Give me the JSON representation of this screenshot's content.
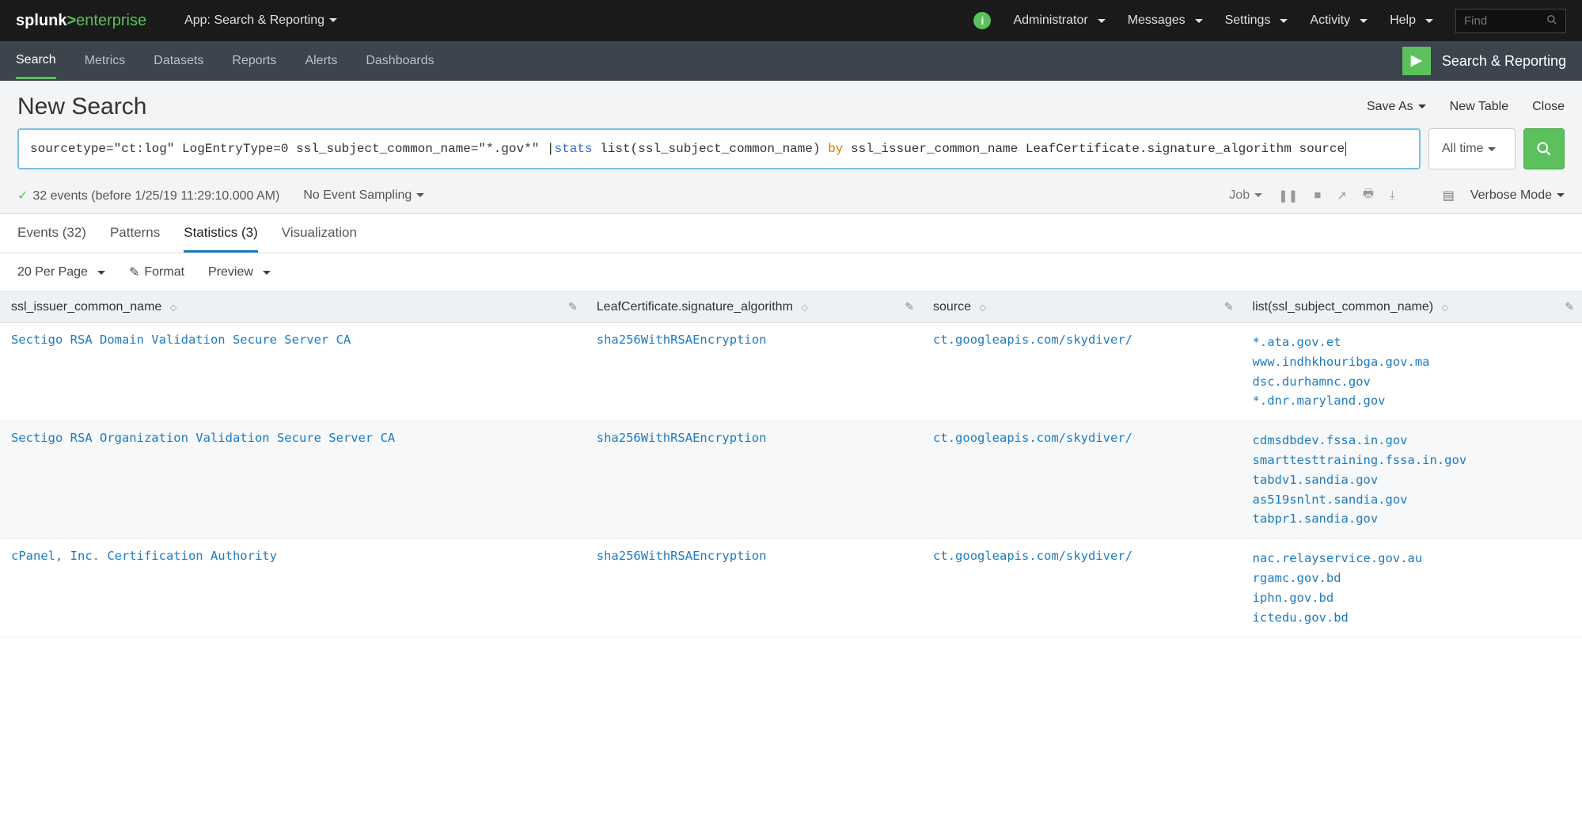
{
  "topbar": {
    "logo_prefix": "splunk",
    "logo_suffix": "enterprise",
    "app_label": "App: Search & Reporting",
    "items": [
      "Administrator",
      "Messages",
      "Settings",
      "Activity",
      "Help"
    ],
    "find_placeholder": "Find"
  },
  "nav": {
    "tabs": [
      "Search",
      "Metrics",
      "Datasets",
      "Reports",
      "Alerts",
      "Dashboards"
    ],
    "active_index": 0,
    "app_name": "Search & Reporting"
  },
  "search_header": {
    "title": "New Search",
    "actions": [
      "Save As",
      "New Table",
      "Close"
    ]
  },
  "search_query": {
    "prefix": "sourcetype=\"ct:log\" LogEntryType=0 ssl_subject_common_name=\"*.gov*\" | ",
    "cmd1": "stats",
    "mid1": " list(ssl_subject_common_name) ",
    "cmd2": "by",
    "suffix": " ssl_issuer_common_name LeafCertificate.signature_algorithm source"
  },
  "time_picker": "All time",
  "status": {
    "events_text": "32 events (before 1/25/19 11:29:10.000 AM)",
    "sampling": "No Event Sampling",
    "job_label": "Job",
    "mode": "Verbose Mode"
  },
  "result_tabs": {
    "items": [
      "Events (32)",
      "Patterns",
      "Statistics (3)",
      "Visualization"
    ],
    "active_index": 2
  },
  "table_toolbar": {
    "per_page": "20 Per Page",
    "format": "Format",
    "preview": "Preview"
  },
  "columns": [
    "ssl_issuer_common_name",
    "LeafCertificate.signature_algorithm",
    "source",
    "list(ssl_subject_common_name)"
  ],
  "rows": [
    {
      "issuer": "Sectigo RSA Domain Validation Secure Server CA",
      "algo": "sha256WithRSAEncryption",
      "source": "ct.googleapis.com/skydiver/",
      "cns": [
        "*.ata.gov.et",
        "www.indhkhouribga.gov.ma",
        "dsc.durhamnc.gov",
        "*.dnr.maryland.gov"
      ]
    },
    {
      "issuer": "Sectigo RSA Organization Validation Secure Server CA",
      "algo": "sha256WithRSAEncryption",
      "source": "ct.googleapis.com/skydiver/",
      "cns": [
        "cdmsdbdev.fssa.in.gov",
        "smarttesttraining.fssa.in.gov",
        "tabdv1.sandia.gov",
        "as519snlnt.sandia.gov",
        "tabpr1.sandia.gov"
      ]
    },
    {
      "issuer": "cPanel, Inc. Certification Authority",
      "algo": "sha256WithRSAEncryption",
      "source": "ct.googleapis.com/skydiver/",
      "cns": [
        "nac.relayservice.gov.au",
        "rgamc.gov.bd",
        "iphn.gov.bd",
        "ictedu.gov.bd"
      ]
    }
  ]
}
